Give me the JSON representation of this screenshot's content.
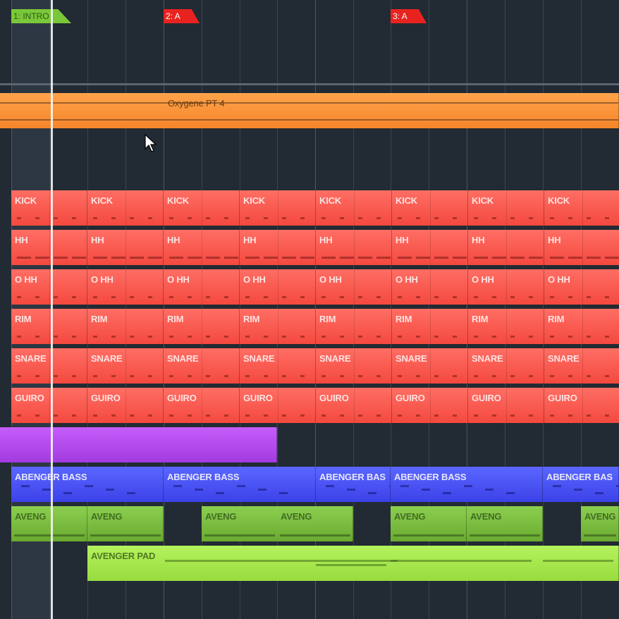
{
  "markers": [
    {
      "label": "1: INTRO",
      "color": "#7ac83a"
    },
    {
      "label": "2: A",
      "color": "#e8231f"
    },
    {
      "label": "3: A",
      "color": "#e8231f"
    }
  ],
  "audio_clip": {
    "label": "Oxygene PT 4",
    "color": "#f5862a"
  },
  "drum_tracks": [
    {
      "label": "KICK",
      "repeats": 8,
      "color": "#f4493f"
    },
    {
      "label": "HH",
      "repeats": 8,
      "color": "#f4493f"
    },
    {
      "label": "O HH",
      "repeats": 8,
      "color": "#f4493f"
    },
    {
      "label": "RIM",
      "repeats": 8,
      "color": "#f4493f"
    },
    {
      "label": "SNARE",
      "repeats": 8,
      "color": "#f4493f"
    },
    {
      "label": "GUIRO",
      "repeats": 8,
      "color": "#f4493f"
    }
  ],
  "purple_clip": {
    "label": "",
    "color": "#a23be0"
  },
  "bass_clips": [
    {
      "label": "ABENGER BASS"
    },
    {
      "label": "ABENGER BASS"
    },
    {
      "label": "ABENGER BAS"
    },
    {
      "label": "ABENGER BASS"
    },
    {
      "label": "ABENGER BAS"
    }
  ],
  "lead_clips": [
    {
      "label": "AVENG"
    },
    {
      "label": "AVENG"
    },
    {
      "label": "AVENG"
    },
    {
      "label": "AVENG"
    },
    {
      "label": "AVENG"
    },
    {
      "label": "AVENG"
    },
    {
      "label": "AVENG"
    }
  ],
  "pad_clip": {
    "label": "AVENGER PAD",
    "color": "#98dc3e"
  }
}
